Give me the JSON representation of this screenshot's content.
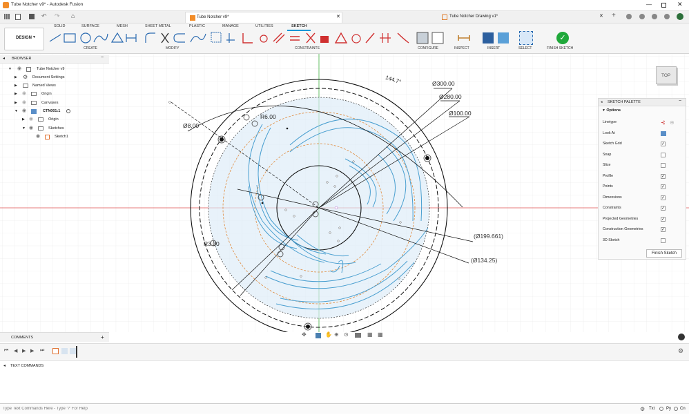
{
  "window": {
    "title": "Tube Notcher v9* - Autodesk Fusion"
  },
  "doc_tabs": [
    {
      "label": "Tube Notcher v9*"
    },
    {
      "label": "Tube Notcher Drawing v1*"
    }
  ],
  "ribbon": {
    "tabs": [
      "SOLID",
      "SURFACE",
      "MESH",
      "SHEET METAL",
      "PLASTIC",
      "MANAGE",
      "UTILITIES",
      "SKETCH"
    ],
    "workspace": "DESIGN",
    "groups": {
      "create": "CREATE",
      "modify": "MODIFY",
      "constraints": "CONSTRAINTS",
      "configure": "CONFIGURE",
      "inspect": "INSPECT",
      "insert": "INSERT",
      "select": "SELECT",
      "finish": "FINISH SKETCH"
    }
  },
  "browser": {
    "title": "BROWSER",
    "items": [
      {
        "label": "Tube Notcher v9"
      },
      {
        "label": "Document Settings"
      },
      {
        "label": "Named Views"
      },
      {
        "label": "Origin"
      },
      {
        "label": "Canvases"
      },
      {
        "label": "CTN001:1"
      },
      {
        "label": "Origin"
      },
      {
        "label": "Sketches"
      },
      {
        "label": "Sketch1"
      }
    ]
  },
  "viewcube": {
    "label": "TOP"
  },
  "sketch": {
    "dims": {
      "d300": "Ø300.00",
      "d280": "Ø280.00",
      "d100": "Ø100.00",
      "d8": "Ø8.00",
      "r6": "R6.00",
      "r3": "R3.00",
      "d199": "(Ø199.661)",
      "d134": "(Ø134.25)",
      "angle": "144.7°"
    }
  },
  "palette": {
    "title": "SKETCH PALETTE",
    "section": "Options",
    "rows": [
      {
        "label": "Linetype",
        "type": "icon"
      },
      {
        "label": "Look At",
        "type": "icon"
      },
      {
        "label": "Sketch Grid",
        "checked": true
      },
      {
        "label": "Snap",
        "checked": false
      },
      {
        "label": "Slice",
        "checked": false
      },
      {
        "label": "Profile",
        "checked": true
      },
      {
        "label": "Points",
        "checked": true
      },
      {
        "label": "Dimensions",
        "checked": true
      },
      {
        "label": "Constraints",
        "checked": true
      },
      {
        "label": "Projected Geometries",
        "checked": true
      },
      {
        "label": "Construction Geometries",
        "checked": true
      },
      {
        "label": "3D Sketch",
        "checked": false
      }
    ],
    "finish": "Finish Sketch"
  },
  "comments": {
    "label": "COMMENTS"
  },
  "text_commands": {
    "label": "TEXT COMMANDS",
    "placeholder": "Type Text Commands Here - Type '?' For Help",
    "modes": [
      "Txt",
      "Py",
      "Cn"
    ]
  },
  "colors": {
    "accent": "#0696d7",
    "sketch": "#4a9fd0",
    "profile_fill": "#dcebf7",
    "construction": "#e08a3c",
    "axis_red": "#e05050",
    "axis_green": "#40b040",
    "check_green": "#1fa83a"
  }
}
